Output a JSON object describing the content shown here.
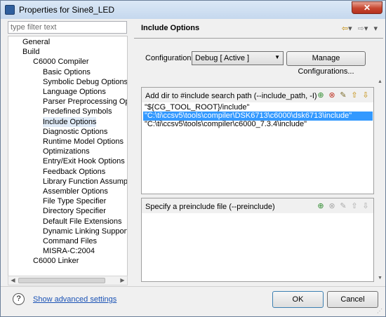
{
  "window": {
    "title": "Properties for Sine8_LED",
    "close_glyph": "✕"
  },
  "filter": {
    "placeholder": "type filter text"
  },
  "tree": {
    "items": [
      {
        "label": "General",
        "level": 1
      },
      {
        "label": "Build",
        "level": 1
      },
      {
        "label": "C6000 Compiler",
        "level": 2
      },
      {
        "label": "Basic Options",
        "level": 3
      },
      {
        "label": "Symbolic Debug Options",
        "level": 3
      },
      {
        "label": "Language Options",
        "level": 3
      },
      {
        "label": "Parser Preprocessing Options",
        "level": 3
      },
      {
        "label": "Predefined Symbols",
        "level": 3
      },
      {
        "label": "Include Options",
        "level": 3,
        "selected": true
      },
      {
        "label": "Diagnostic Options",
        "level": 3
      },
      {
        "label": "Runtime Model Options",
        "level": 3
      },
      {
        "label": "Optimizations",
        "level": 3
      },
      {
        "label": "Entry/Exit Hook Options",
        "level": 3
      },
      {
        "label": "Feedback Options",
        "level": 3
      },
      {
        "label": "Library Function Assumption",
        "level": 3
      },
      {
        "label": "Assembler Options",
        "level": 3
      },
      {
        "label": "File Type Specifier",
        "level": 3
      },
      {
        "label": "Directory Specifier",
        "level": 3
      },
      {
        "label": "Default File Extensions",
        "level": 3
      },
      {
        "label": "Dynamic Linking Support Opt",
        "level": 3
      },
      {
        "label": "Command Files",
        "level": 3
      },
      {
        "label": "MISRA-C:2004",
        "level": 3
      },
      {
        "label": "C6000 Linker",
        "level": 2
      }
    ]
  },
  "main": {
    "heading": "Include Options",
    "nav_icons": [
      "⇦",
      "▾",
      "⇨",
      "▾",
      "▾"
    ],
    "configuration_label": "Configuration:",
    "configuration_value": "Debug  [ Active ]",
    "manage_button": "Manage Configurations...",
    "include_panel": {
      "header": "Add dir to #include search path (--include_path, -I)",
      "paths": [
        "\"${CG_TOOL_ROOT}/include\"",
        "\"C:\\ti\\ccsv5\\tools\\compiler\\DSK6713\\c6000\\dsk6713\\include\"",
        "\"C:\\ti\\ccsv5\\tools\\compiler\\c6000_7.3.4\\include\""
      ],
      "selected_index": 1,
      "icons": [
        "add-icon",
        "delete-icon",
        "edit-icon",
        "move-up-icon",
        "move-down-icon"
      ]
    },
    "preinclude_panel": {
      "header": "Specify a preinclude file (--preinclude)",
      "icons": [
        "add-icon",
        "delete-icon",
        "edit-icon",
        "move-up-icon",
        "move-down-icon"
      ]
    }
  },
  "footer": {
    "help_glyph": "?",
    "advanced_link": "Show advanced settings",
    "ok": "OK",
    "cancel": "Cancel"
  },
  "colors": {
    "selection": "#3399ff",
    "tree_selection": "#e1ecf8",
    "link": "#1a52b5"
  }
}
